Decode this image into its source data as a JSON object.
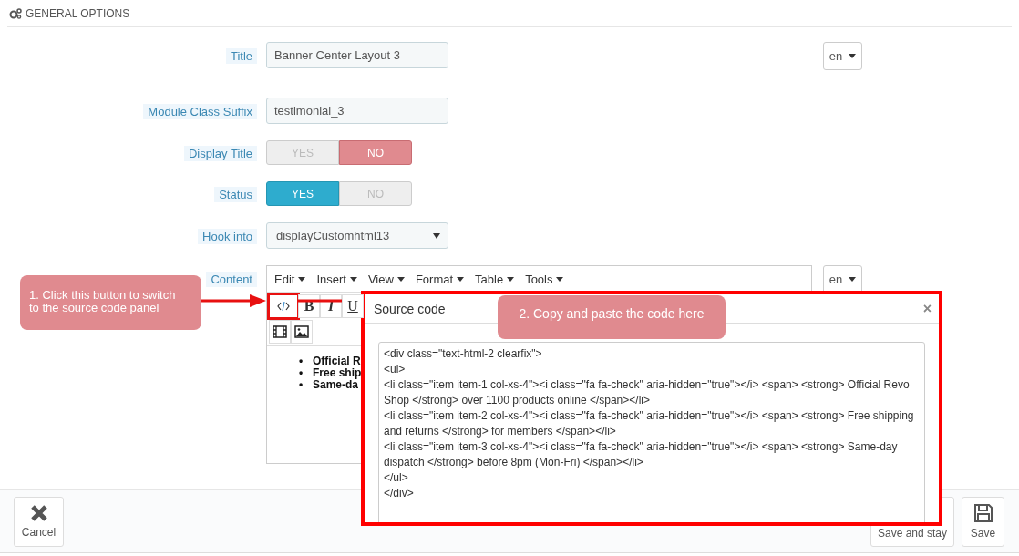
{
  "section": {
    "title": "GENERAL OPTIONS"
  },
  "fields": [
    {
      "kind": "text",
      "label": "Title",
      "value": "Banner Center Layout 3",
      "language": "en"
    },
    {
      "kind": "text",
      "label": "Module Class Suffix",
      "value": "testimonial_3"
    },
    {
      "kind": "switch",
      "label": "Display Title",
      "options": [
        {
          "label": "YES",
          "selected": false
        },
        {
          "label": "NO",
          "selected": true
        }
      ]
    },
    {
      "kind": "switch",
      "label": "Status",
      "options": [
        {
          "label": "YES",
          "selected": true
        },
        {
          "label": "NO",
          "selected": false
        }
      ]
    },
    {
      "kind": "select",
      "label": "Hook into",
      "value": "displayCustomhtml13"
    },
    {
      "kind": "editor",
      "label": "Content",
      "language": "en"
    }
  ],
  "editor": {
    "menus": [
      "Edit",
      "Insert",
      "View",
      "Format",
      "Table",
      "Tools"
    ],
    "toolbar": [
      [
        {
          "kind": "code",
          "highlighted": true
        },
        {
          "kind": "bold",
          "label": "B"
        },
        {
          "kind": "italic",
          "label": "I"
        },
        {
          "kind": "underline",
          "label": "U"
        }
      ],
      [
        {
          "kind": "video"
        },
        {
          "kind": "image"
        }
      ]
    ],
    "bullets": [
      {
        "marker": "•",
        "text": "Official R"
      },
      {
        "marker": "•",
        "text": "Free ship"
      },
      {
        "marker": "•",
        "text": "Same-da"
      }
    ]
  },
  "dialog": {
    "title": "Source code",
    "close": "×",
    "code_lines": [
      "<div class=\"text-html-2 clearfix\">",
      "<ul>",
      "<li class=\"item item-1 col-xs-4\"><i class=\"fa fa-check\" aria-hidden=\"true\"></i> <span> <strong> Official Revo Shop </strong> over 1100 products online </span></li>",
      "<li class=\"item item-2 col-xs-4\"><i class=\"fa fa-check\" aria-hidden=\"true\"></i> <span> <strong> Free shipping and returns </strong> for members </span></li>",
      "<li class=\"item item-3 col-xs-4\"><i class=\"fa fa-check\" aria-hidden=\"true\"></i> <span> <strong> Same-day dispatch </strong> before 8pm (Mon-Fri) </span></li>",
      "</ul>",
      "</div>"
    ]
  },
  "callouts": [
    {
      "kind": "left",
      "text": "1. Click this button to switch to the source code panel"
    },
    {
      "kind": "dialog",
      "text": "2. Copy and paste the code here"
    }
  ],
  "footer": {
    "buttons": [
      {
        "kind": "cancel",
        "label": "Cancel"
      },
      {
        "kind": "save-stay",
        "label": "Save and stay"
      },
      {
        "kind": "save",
        "label": "Save"
      }
    ]
  }
}
